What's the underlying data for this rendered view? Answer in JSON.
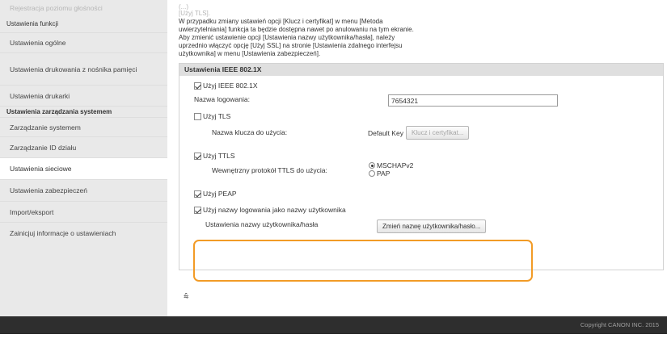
{
  "sidebar": {
    "faded_top": "Rejestracja poziomu głośności",
    "group1": "Ustawienia funkcji",
    "group1_items": [
      {
        "label": "Ustawienia ogólne"
      },
      {
        "label": "Ustawienia drukowania z nośnika pamięci"
      },
      {
        "label": "Ustawienia drukarki"
      }
    ],
    "group2": "Ustawienia zarządzania systemem",
    "group2_items": [
      {
        "label": "Zarządzanie systemem"
      },
      {
        "label": "Zarządzanie ID działu"
      },
      {
        "label": "Ustawienia sieciowe"
      },
      {
        "label": "Ustawienia zabezpieczeń"
      },
      {
        "label": "Import/eksport"
      },
      {
        "label": "Zainicjuj informacje o ustawieniach"
      }
    ]
  },
  "info": {
    "faded_line1": "(...)",
    "faded_line2": "[Użyj TLS].",
    "line1": "W przypadku zmiany ustawień opcji [Klucz i certyfikat] w menu [Metoda",
    "line2": "uwierzytelniania] funkcja ta będzie dostępna nawet po anulowaniu na tym ekranie.",
    "line3": "Aby zmienić ustawienie opcji [Ustawienia nazwy użytkownika/hasła], należy",
    "line4": "uprzednio włączyć opcję [Użyj SSL] na stronie [Ustawienia zdalnego interfejsu",
    "line5": "użytkownika] w menu [Ustawienia zabezpieczeń]."
  },
  "ieee": {
    "title": "Ustawienia IEEE 802.1X",
    "use_ieee_label": "Użyj IEEE 802.1X",
    "login_name_label": "Nazwa logowania:",
    "login_name_value": "7654321",
    "use_tls_label": "Użyj TLS",
    "key_label": "Nazwa klucza do użycia:",
    "key_value": "Default Key",
    "key_button": "Klucz i certyfikat...",
    "use_ttls_label": "Użyj TTLS",
    "ttls_protocol_label": "Wewnętrzny protokół TTLS do użycia:",
    "ttls_opt1": "MSCHAPv2",
    "ttls_opt2": "PAP",
    "use_peap_label": "Użyj PEAP",
    "use_login_as_user_label": "Użyj nazwy logowania jako nazwy użytkownika",
    "user_settings_label": "Ustawienia nazwy użytkownika/hasła",
    "change_button": "Zmień nazwę użytkownika/hasło..."
  },
  "back_to_top_glyph": "⩯",
  "footer": {
    "copyright": "Copyright CANON INC. 2015"
  },
  "colors": {
    "highlight": "#f29b26"
  }
}
